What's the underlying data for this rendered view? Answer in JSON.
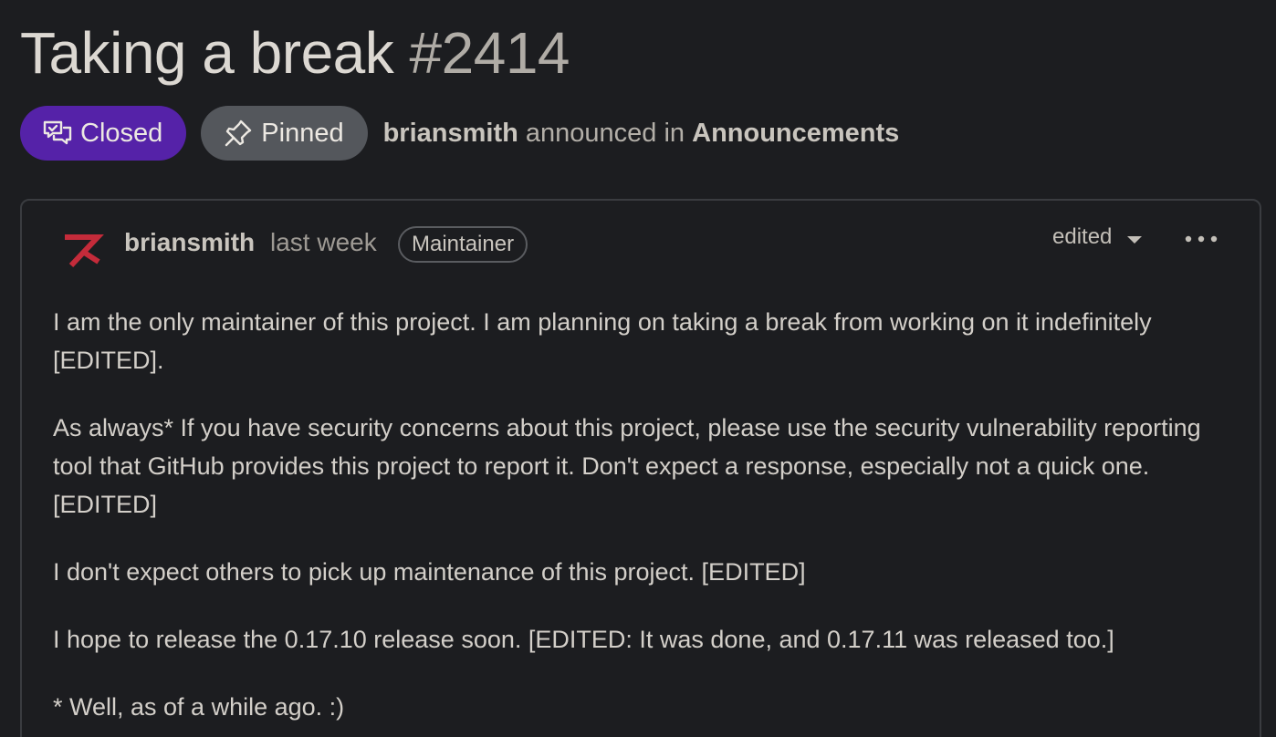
{
  "discussion": {
    "title": "Taking a break",
    "number": "#2414",
    "status_label": "Closed",
    "pinned_label": "Pinned",
    "author": "briansmith",
    "announced_text": "announced in",
    "category": "Announcements"
  },
  "post": {
    "author": "briansmith",
    "time": "last week",
    "role": "Maintainer",
    "edited_label": "edited",
    "paragraphs": [
      "I am the only maintainer of this project. I am planning on taking a break from working on it indefinitely [EDITED].",
      "As always* If you have security concerns about this project, please use the security vulnerability reporting tool that GitHub provides this project to report it. Don't expect a response, especially not a quick one. [EDITED]",
      "I don't expect others to pick up maintenance of this project. [EDITED]",
      "I hope to release the 0.17.10 release soon. [EDITED: It was done, and 0.17.11 was released too.]",
      "* Well, as of a while ago. :)"
    ]
  },
  "icons": {
    "status": "discussion-closed-icon",
    "pinned": "pin-icon",
    "avatar": "user-avatar",
    "edited_caret": "triangle-down-icon",
    "more": "kebab-horizontal-icon"
  },
  "colors": {
    "background": "#1c1d20",
    "closed_badge": "#5522a8",
    "pinned_badge": "#54575c",
    "avatar_red": "#c42b3a"
  }
}
